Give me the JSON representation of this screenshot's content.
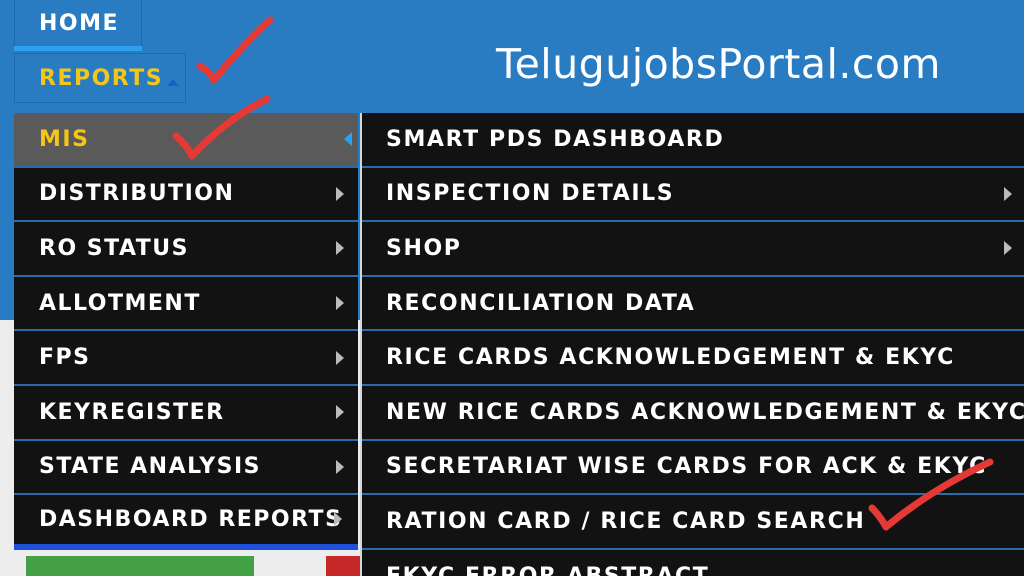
{
  "nav": {
    "home_label": "HOME",
    "reports_label": "REPORTS"
  },
  "brand": {
    "title": "TelugujobsPortal.com"
  },
  "menu": {
    "items": [
      {
        "label": "MIS",
        "active": true
      },
      {
        "label": "DISTRIBUTION"
      },
      {
        "label": "RO STATUS"
      },
      {
        "label": "ALLOTMENT"
      },
      {
        "label": "FPS"
      },
      {
        "label": "KEYREGISTER"
      },
      {
        "label": "STATE ANALYSIS"
      },
      {
        "label": "DASHBOARD REPORTS"
      }
    ]
  },
  "submenu": {
    "items": [
      {
        "label": "SMART PDS DASHBOARD"
      },
      {
        "label": "INSPECTION DETAILS",
        "has_children": true
      },
      {
        "label": "SHOP",
        "has_children": true
      },
      {
        "label": "RECONCILIATION DATA"
      },
      {
        "label": "RICE CARDS ACKNOWLEDGEMENT & EKYC"
      },
      {
        "label": "NEW RICE CARDS ACKNOWLEDGEMENT & EKYC"
      },
      {
        "label": "SECRETARIAT WISE CARDS FOR ACK & EKYC"
      },
      {
        "label": "RATION CARD / RICE CARD SEARCH"
      },
      {
        "label": "EKYC ERROR ABSTRACT"
      }
    ]
  },
  "colors": {
    "header_blue": "#2a7cc2",
    "menu_bg": "#121212",
    "active_text": "#f5c518",
    "check_mark": "#e53935"
  }
}
